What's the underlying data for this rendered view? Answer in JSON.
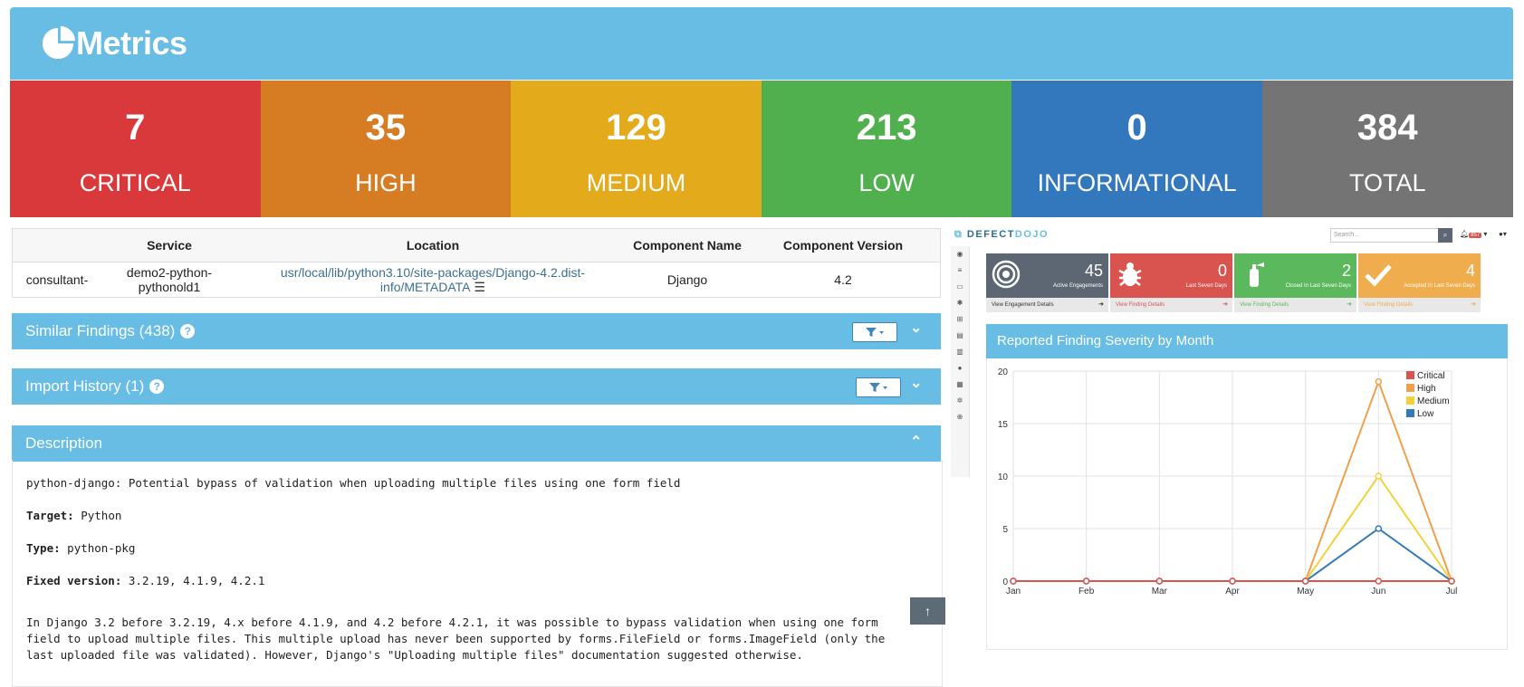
{
  "header": {
    "title": "Metrics",
    "logo_icon": "pie-chart-icon"
  },
  "stats": [
    {
      "id": "critical",
      "value": "7",
      "label": "CRITICAL",
      "color": "#d9393b"
    },
    {
      "id": "high",
      "value": "35",
      "label": "HIGH",
      "color": "#d67d24"
    },
    {
      "id": "medium",
      "value": "129",
      "label": "MEDIUM",
      "color": "#e3ab1b"
    },
    {
      "id": "low",
      "value": "213",
      "label": "LOW",
      "color": "#4fb04d"
    },
    {
      "id": "informational",
      "value": "0",
      "label": "INFORMATIONAL",
      "color": "#3377bd"
    },
    {
      "id": "total",
      "value": "384",
      "label": "TOTAL",
      "color": "#747474"
    }
  ],
  "component_table": {
    "headers": [
      "",
      "Service",
      "Location",
      "Component Name",
      "Component Version"
    ],
    "row": {
      "reporter": "consultant-",
      "service": "demo2-python-pythonold1",
      "location": "usr/local/lib/python3.10/site-packages/Django-4.2.dist-info/METADATA",
      "component_name": "Django",
      "component_version": "4.2"
    }
  },
  "panels": {
    "similar_findings": "Similar Findings (438)",
    "import_history": "Import History (1)",
    "description": "Description",
    "help_glyph": "?"
  },
  "description": {
    "summary": "python-django: Potential bypass of validation when uploading multiple files using one form field",
    "target_label": "Target:",
    "target_value": "Python",
    "type_label": "Type:",
    "type_value": "python-pkg",
    "fixed_label": "Fixed version:",
    "fixed_value": "3.2.19, 4.1.9, 4.2.1",
    "para_line1": "In Django 3.2 before 3.2.19, 4.x before 4.1.9, and 4.2 before 4.2.1, it was possible to bypass validation when using one form",
    "para_line2": "field to upload multiple files. This multiple upload has never been supported by forms.FileField or forms.ImageField (only the",
    "para_line3": "last uploaded file was validated). However, Django's \"Uploading multiple files\" documentation suggested otherwise."
  },
  "dojo": {
    "brand_a": "DEFECT",
    "brand_b": "DOJO",
    "search_placeholder": "Search...",
    "badge": "857",
    "cards": [
      {
        "value": "45",
        "label": "Active Engagements",
        "footer": "View Engagement Details",
        "color": "#5c6773",
        "footer_color": "#333333",
        "icon": "target-icon"
      },
      {
        "value": "0",
        "label": "Last Seven Days",
        "footer": "View Finding Details",
        "color": "#d9534f",
        "footer_color": "#d9534f",
        "icon": "bug-icon"
      },
      {
        "value": "2",
        "label": "Closed In Last Seven Days",
        "footer": "View Finding Details",
        "color": "#5cb85c",
        "footer_color": "#5cb85c",
        "icon": "fire-extinguisher-icon"
      },
      {
        "value": "4",
        "label": "Accepted In Last Seven Days",
        "footer": "View Finding Details",
        "color": "#f0ad4e",
        "footer_color": "#f0ad4e",
        "icon": "check-icon"
      }
    ],
    "chart_title": "Reported Finding Severity by Month"
  },
  "chart_data": {
    "type": "line",
    "title": "Reported Finding Severity by Month",
    "categories": [
      "Jan",
      "Feb",
      "Mar",
      "Apr",
      "May",
      "Jun",
      "Jul"
    ],
    "series": [
      {
        "name": "Critical",
        "color": "#d9534f",
        "values": [
          0,
          0,
          0,
          0,
          0,
          0,
          0
        ]
      },
      {
        "name": "High",
        "color": "#f0a04b",
        "values": [
          0,
          0,
          0,
          0,
          0,
          19,
          0
        ]
      },
      {
        "name": "Medium",
        "color": "#f2d23c",
        "values": [
          0,
          0,
          0,
          0,
          0,
          10,
          0
        ]
      },
      {
        "name": "Low",
        "color": "#337ab7",
        "values": [
          0,
          0,
          0,
          0,
          0,
          5,
          0
        ]
      }
    ],
    "yticks": [
      0,
      5,
      10,
      15,
      20
    ],
    "ylim": [
      0,
      20
    ],
    "grid": true,
    "legend": "top-right"
  }
}
